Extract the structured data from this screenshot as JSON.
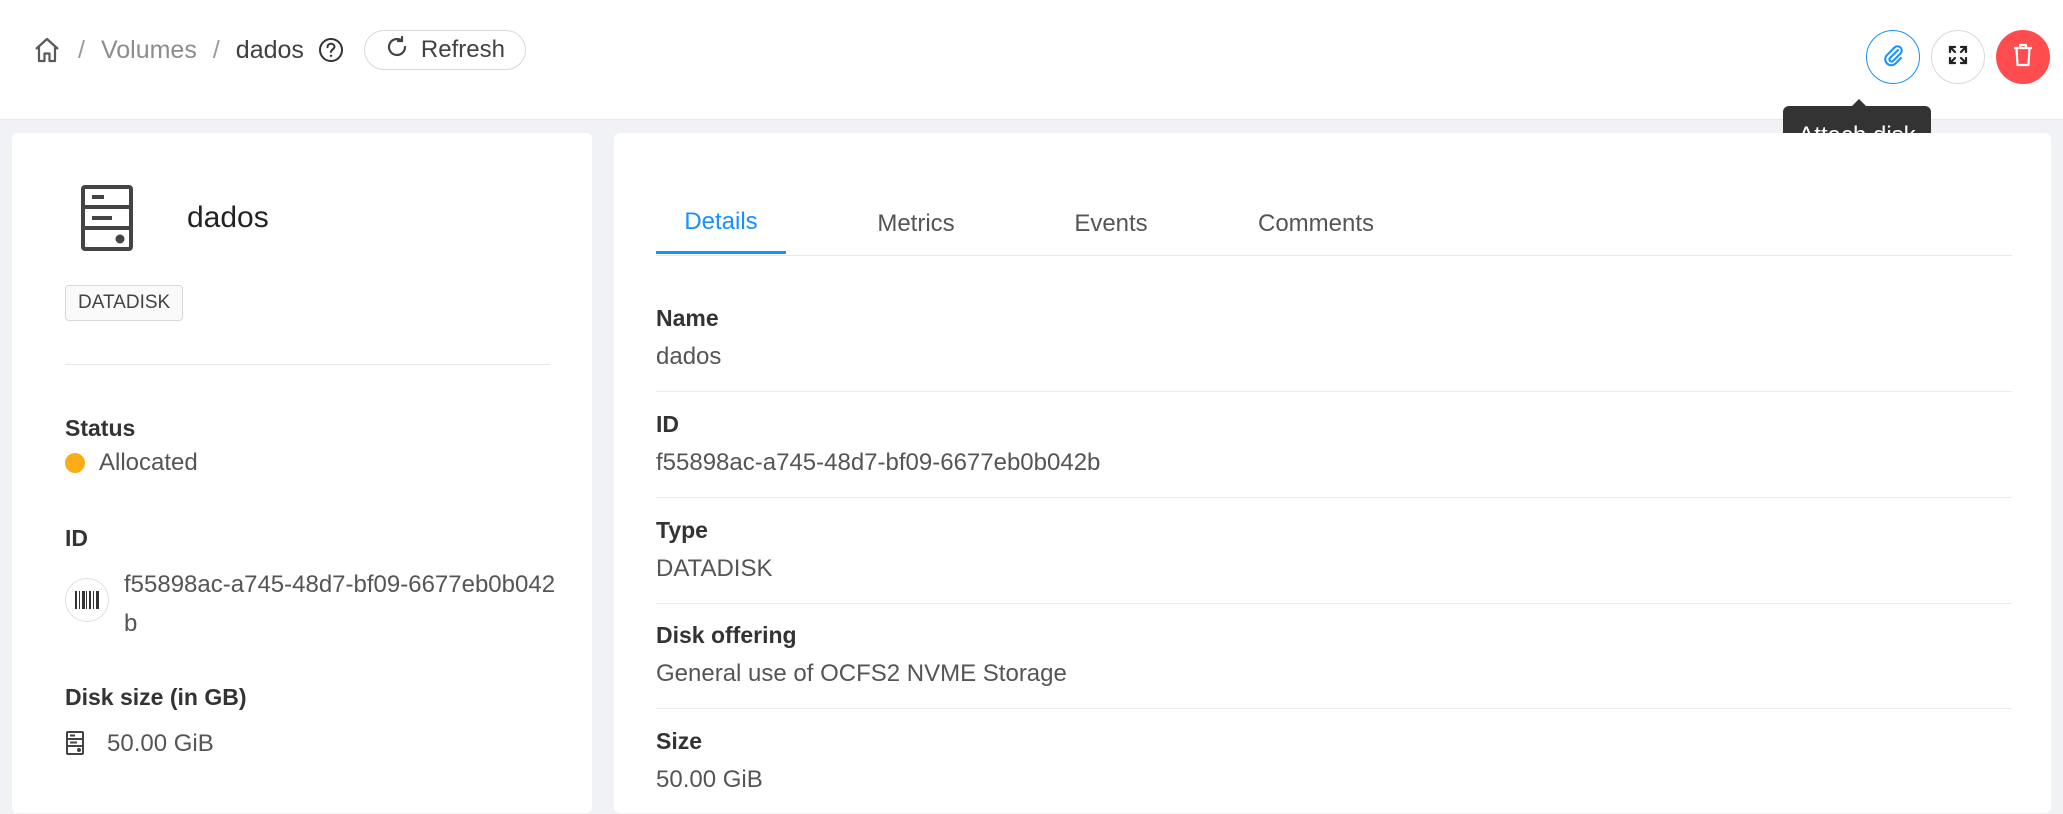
{
  "breadcrumb": {
    "home_icon": "home-icon",
    "items": [
      "Volumes",
      "dados"
    ],
    "separator": "/",
    "help_icon": "question-circle-icon"
  },
  "toolbar": {
    "refresh_label": "Refresh",
    "refresh_icon": "reload-icon",
    "actions": [
      {
        "name": "attach-disk",
        "icon": "paperclip-icon",
        "tooltip": "Attach disk"
      },
      {
        "name": "fullscreen",
        "icon": "expand-icon"
      },
      {
        "name": "delete",
        "icon": "trash-icon"
      }
    ],
    "tooltip_text": "Attach disk"
  },
  "colors": {
    "accent": "#1890ff",
    "danger": "#ff4d4f",
    "status_allocated": "#faad14"
  },
  "summary": {
    "icon": "server-icon",
    "name": "dados",
    "type_tag": "DATADISK",
    "status_label": "Status",
    "status_value": "Allocated",
    "id_label": "ID",
    "id_value": "f55898ac-a745-48d7-bf09-6677eb0b042b",
    "id_icon": "barcode-icon",
    "disk_size_label": "Disk size (in GB)",
    "disk_size_value": "50.00 GiB",
    "disk_size_icon": "hdd-icon"
  },
  "tabs": [
    {
      "label": "Details",
      "active": true
    },
    {
      "label": "Metrics",
      "active": false
    },
    {
      "label": "Events",
      "active": false
    },
    {
      "label": "Comments",
      "active": false
    }
  ],
  "details": [
    {
      "label": "Name",
      "value": "dados"
    },
    {
      "label": "ID",
      "value": "f55898ac-a745-48d7-bf09-6677eb0b042b"
    },
    {
      "label": "Type",
      "value": "DATADISK"
    },
    {
      "label": "Disk offering",
      "value": "General use of OCFS2 NVME Storage"
    },
    {
      "label": "Size",
      "value": "50.00 GiB"
    }
  ]
}
